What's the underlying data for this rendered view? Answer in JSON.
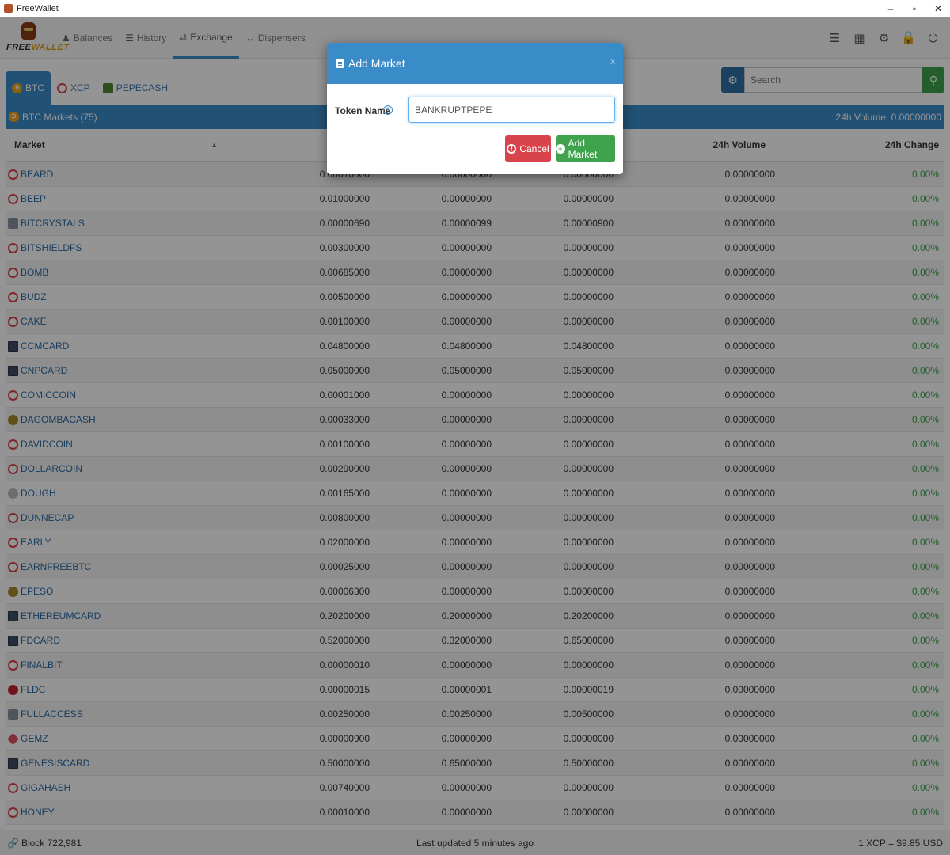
{
  "window": {
    "title": "FreeWallet",
    "controls": [
      "–",
      "▫",
      "✕"
    ]
  },
  "logo": {
    "text_a": "FREE",
    "text_b": "WALLET"
  },
  "nav": {
    "links": [
      {
        "label": "Balances",
        "icon": "user-icon"
      },
      {
        "label": "History",
        "icon": "list-icon"
      },
      {
        "label": "Exchange",
        "icon": "exchange-icon"
      },
      {
        "label": "Dispensers",
        "icon": "arrows-icon"
      }
    ],
    "active": "Exchange",
    "right_icons": [
      "list-icon",
      "qrcode-icon",
      "cogs-icon",
      "unlock-icon",
      "power-icon"
    ]
  },
  "currency_tabs": [
    {
      "label": "BTC",
      "icon": "btc-icon",
      "active": true
    },
    {
      "label": "XCP",
      "icon": "xcp-icon",
      "active": false
    },
    {
      "label": "PEPECASH",
      "icon": "pepecash-icon",
      "active": false
    }
  ],
  "search": {
    "placeholder": "Search"
  },
  "markets_bar": {
    "title": "BTC Markets (75)",
    "volume": "24h Volume: 0.00000000"
  },
  "table": {
    "headers": {
      "market": "Market",
      "volume": "24h Volume",
      "change": "24h Change"
    },
    "rows": [
      {
        "market": "BEARD",
        "icon": "xcp",
        "c1": "0.00010000",
        "c2": "0.00000000",
        "c3": "0.00000000",
        "vol": "0.00000000",
        "chg": "0.00%"
      },
      {
        "market": "BEEP",
        "icon": "xcp",
        "c1": "0.01000000",
        "c2": "0.00000000",
        "c3": "0.00000000",
        "vol": "0.00000000",
        "chg": "0.00%"
      },
      {
        "market": "BITCRYSTALS",
        "icon": "grey",
        "c1": "0.00000690",
        "c2": "0.00000099",
        "c3": "0.00000900",
        "vol": "0.00000000",
        "chg": "0.00%"
      },
      {
        "market": "BITSHIELDFS",
        "icon": "xcp",
        "c1": "0.00300000",
        "c2": "0.00000000",
        "c3": "0.00000000",
        "vol": "0.00000000",
        "chg": "0.00%"
      },
      {
        "market": "BOMB",
        "icon": "xcp",
        "c1": "0.00685000",
        "c2": "0.00000000",
        "c3": "0.00000000",
        "vol": "0.00000000",
        "chg": "0.00%"
      },
      {
        "market": "BUDZ",
        "icon": "xcp",
        "c1": "0.00500000",
        "c2": "0.00000000",
        "c3": "0.00000000",
        "vol": "0.00000000",
        "chg": "0.00%"
      },
      {
        "market": "CAKE",
        "icon": "xcp",
        "c1": "0.00100000",
        "c2": "0.00000000",
        "c3": "0.00000000",
        "vol": "0.00000000",
        "chg": "0.00%"
      },
      {
        "market": "CCMCARD",
        "icon": "card",
        "c1": "0.04800000",
        "c2": "0.04800000",
        "c3": "0.04800000",
        "vol": "0.00000000",
        "chg": "0.00%"
      },
      {
        "market": "CNPCARD",
        "icon": "card",
        "c1": "0.05000000",
        "c2": "0.05000000",
        "c3": "0.05000000",
        "vol": "0.00000000",
        "chg": "0.00%"
      },
      {
        "market": "COMICCOIN",
        "icon": "xcp",
        "c1": "0.00001000",
        "c2": "0.00000000",
        "c3": "0.00000000",
        "vol": "0.00000000",
        "chg": "0.00%"
      },
      {
        "market": "DAGOMBACASH",
        "icon": "gold",
        "c1": "0.00033000",
        "c2": "0.00000000",
        "c3": "0.00000000",
        "vol": "0.00000000",
        "chg": "0.00%"
      },
      {
        "market": "DAVIDCOIN",
        "icon": "xcp",
        "c1": "0.00100000",
        "c2": "0.00000000",
        "c3": "0.00000000",
        "vol": "0.00000000",
        "chg": "0.00%"
      },
      {
        "market": "DOLLARCOIN",
        "icon": "xcp",
        "c1": "0.00290000",
        "c2": "0.00000000",
        "c3": "0.00000000",
        "vol": "0.00000000",
        "chg": "0.00%"
      },
      {
        "market": "DOUGH",
        "icon": "silver",
        "c1": "0.00165000",
        "c2": "0.00000000",
        "c3": "0.00000000",
        "vol": "0.00000000",
        "chg": "0.00%"
      },
      {
        "market": "DUNNECAP",
        "icon": "xcp",
        "c1": "0.00800000",
        "c2": "0.00000000",
        "c3": "0.00000000",
        "vol": "0.00000000",
        "chg": "0.00%"
      },
      {
        "market": "EARLY",
        "icon": "xcp",
        "c1": "0.02000000",
        "c2": "0.00000000",
        "c3": "0.00000000",
        "vol": "0.00000000",
        "chg": "0.00%"
      },
      {
        "market": "EARNFREEBTC",
        "icon": "xcp",
        "c1": "0.00025000",
        "c2": "0.00000000",
        "c3": "0.00000000",
        "vol": "0.00000000",
        "chg": "0.00%"
      },
      {
        "market": "EPESO",
        "icon": "gold",
        "c1": "0.00006300",
        "c2": "0.00000000",
        "c3": "0.00000000",
        "vol": "0.00000000",
        "chg": "0.00%"
      },
      {
        "market": "ETHEREUMCARD",
        "icon": "card",
        "c1": "0.20200000",
        "c2": "0.20000000",
        "c3": "0.20200000",
        "vol": "0.00000000",
        "chg": "0.00%"
      },
      {
        "market": "FDCARD",
        "icon": "card",
        "c1": "0.52000000",
        "c2": "0.32000000",
        "c3": "0.65000000",
        "vol": "0.00000000",
        "chg": "0.00%"
      },
      {
        "market": "FINALBIT",
        "icon": "xcp",
        "c1": "0.00000010",
        "c2": "0.00000000",
        "c3": "0.00000000",
        "vol": "0.00000000",
        "chg": "0.00%"
      },
      {
        "market": "FLDC",
        "icon": "red",
        "c1": "0.00000015",
        "c2": "0.00000001",
        "c3": "0.00000019",
        "vol": "0.00000000",
        "chg": "0.00%"
      },
      {
        "market": "FULLACCESS",
        "icon": "grey",
        "c1": "0.00250000",
        "c2": "0.00250000",
        "c3": "0.00500000",
        "vol": "0.00000000",
        "chg": "0.00%"
      },
      {
        "market": "GEMZ",
        "icon": "gem",
        "c1": "0.00000900",
        "c2": "0.00000000",
        "c3": "0.00000000",
        "vol": "0.00000000",
        "chg": "0.00%"
      },
      {
        "market": "GENESISCARD",
        "icon": "card",
        "c1": "0.50000000",
        "c2": "0.65000000",
        "c3": "0.50000000",
        "vol": "0.00000000",
        "chg": "0.00%"
      },
      {
        "market": "GIGAHASH",
        "icon": "xcp",
        "c1": "0.00740000",
        "c2": "0.00000000",
        "c3": "0.00000000",
        "vol": "0.00000000",
        "chg": "0.00%"
      },
      {
        "market": "HONEY",
        "icon": "xcp",
        "c1": "0.00010000",
        "c2": "0.00000000",
        "c3": "0.00000000",
        "vol": "0.00000000",
        "chg": "0.00%"
      }
    ]
  },
  "footer": {
    "block": "Block 722,981",
    "updated": "Last updated 5 minutes ago",
    "price": "1 XCP = $9.85 USD"
  },
  "modal": {
    "title": "Add Market",
    "close": "x",
    "field_label": "Token Name",
    "field_value": "BANKRUPTPEPE",
    "cancel_label": "Cancel",
    "add_label": "Add Market"
  },
  "colors": {
    "primary": "#3a8cc9",
    "success": "#3fa34d",
    "danger": "#d9434b"
  }
}
